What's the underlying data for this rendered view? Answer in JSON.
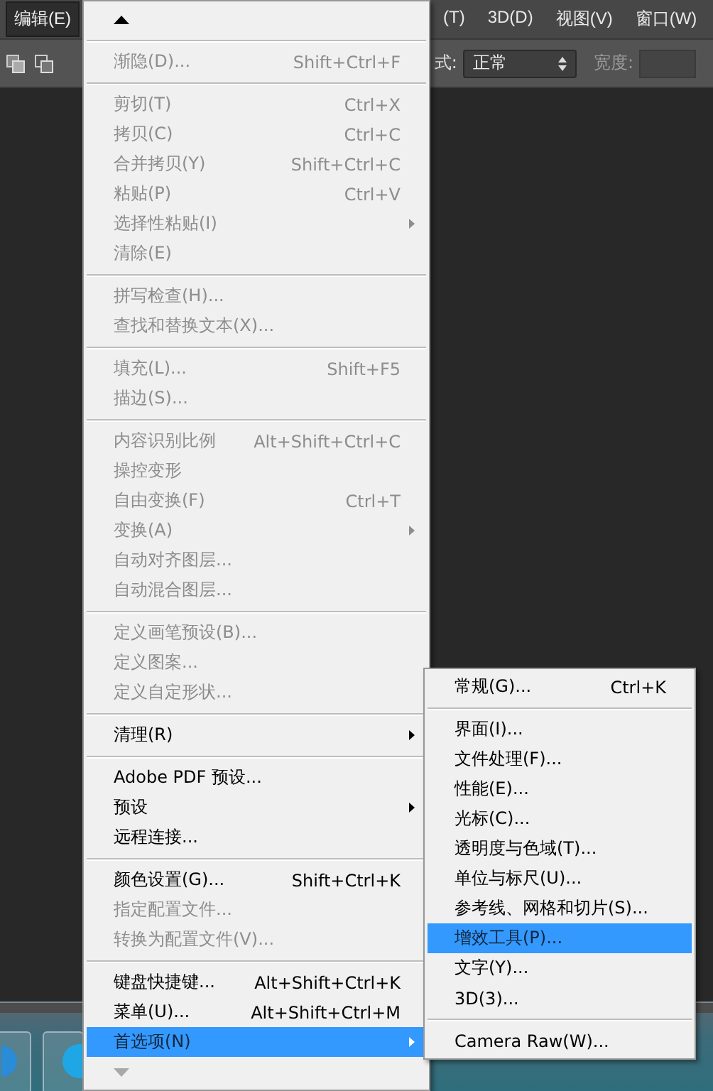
{
  "menu_bar": [
    {
      "label": "编辑(E)",
      "selected": true
    },
    {
      "label": "(T)",
      "selected": false
    },
    {
      "label": "3D(D)",
      "selected": false
    },
    {
      "label": "视图(V)",
      "selected": false
    },
    {
      "label": "窗口(W)",
      "selected": false
    }
  ],
  "options_bar": {
    "style_label": "式:",
    "style_value": "正常",
    "width_label": "宽度:"
  },
  "edit_menu": [
    {
      "kind": "scroll-up",
      "disabled": false
    },
    {
      "kind": "separator"
    },
    {
      "kind": "item",
      "label": "渐隐(D)...",
      "shortcut": "Shift+Ctrl+F",
      "disabled": true,
      "selected": false,
      "submenu": false
    },
    {
      "kind": "separator"
    },
    {
      "kind": "item",
      "label": "剪切(T)",
      "shortcut": "Ctrl+X",
      "disabled": true,
      "selected": false,
      "submenu": false
    },
    {
      "kind": "item",
      "label": "拷贝(C)",
      "shortcut": "Ctrl+C",
      "disabled": true,
      "selected": false,
      "submenu": false
    },
    {
      "kind": "item",
      "label": "合并拷贝(Y)",
      "shortcut": "Shift+Ctrl+C",
      "disabled": true,
      "selected": false,
      "submenu": false
    },
    {
      "kind": "item",
      "label": "粘贴(P)",
      "shortcut": "Ctrl+V",
      "disabled": true,
      "selected": false,
      "submenu": false
    },
    {
      "kind": "item",
      "label": "选择性粘贴(I)",
      "disabled": true,
      "selected": false,
      "submenu": true
    },
    {
      "kind": "item",
      "label": "清除(E)",
      "disabled": true,
      "selected": false,
      "submenu": false
    },
    {
      "kind": "separator"
    },
    {
      "kind": "item",
      "label": "拼写检查(H)...",
      "disabled": true,
      "selected": false,
      "submenu": false
    },
    {
      "kind": "item",
      "label": "查找和替换文本(X)...",
      "disabled": true,
      "selected": false,
      "submenu": false
    },
    {
      "kind": "separator"
    },
    {
      "kind": "item",
      "label": "填充(L)...",
      "shortcut": "Shift+F5",
      "disabled": true,
      "selected": false,
      "submenu": false
    },
    {
      "kind": "item",
      "label": "描边(S)...",
      "disabled": true,
      "selected": false,
      "submenu": false
    },
    {
      "kind": "separator"
    },
    {
      "kind": "item",
      "label": "内容识别比例",
      "shortcut": "Alt+Shift+Ctrl+C",
      "disabled": true,
      "selected": false,
      "submenu": false
    },
    {
      "kind": "item",
      "label": "操控变形",
      "disabled": true,
      "selected": false,
      "submenu": false
    },
    {
      "kind": "item",
      "label": "自由变换(F)",
      "shortcut": "Ctrl+T",
      "disabled": true,
      "selected": false,
      "submenu": false
    },
    {
      "kind": "item",
      "label": "变换(A)",
      "disabled": true,
      "selected": false,
      "submenu": true
    },
    {
      "kind": "item",
      "label": "自动对齐图层...",
      "disabled": true,
      "selected": false,
      "submenu": false
    },
    {
      "kind": "item",
      "label": "自动混合图层...",
      "disabled": true,
      "selected": false,
      "submenu": false
    },
    {
      "kind": "separator"
    },
    {
      "kind": "item",
      "label": "定义画笔预设(B)...",
      "disabled": true,
      "selected": false,
      "submenu": false
    },
    {
      "kind": "item",
      "label": "定义图案...",
      "disabled": true,
      "selected": false,
      "submenu": false
    },
    {
      "kind": "item",
      "label": "定义自定形状...",
      "disabled": true,
      "selected": false,
      "submenu": false
    },
    {
      "kind": "separator"
    },
    {
      "kind": "item",
      "label": "清理(R)",
      "disabled": false,
      "selected": false,
      "submenu": true
    },
    {
      "kind": "separator"
    },
    {
      "kind": "item",
      "label": "Adobe PDF 预设...",
      "disabled": false,
      "selected": false,
      "submenu": false
    },
    {
      "kind": "item",
      "label": "预设",
      "disabled": false,
      "selected": false,
      "submenu": true
    },
    {
      "kind": "item",
      "label": "远程连接...",
      "disabled": false,
      "selected": false,
      "submenu": false
    },
    {
      "kind": "separator"
    },
    {
      "kind": "item",
      "label": "颜色设置(G)...",
      "shortcut": "Shift+Ctrl+K",
      "disabled": false,
      "selected": false,
      "submenu": false
    },
    {
      "kind": "item",
      "label": "指定配置文件...",
      "disabled": true,
      "selected": false,
      "submenu": false
    },
    {
      "kind": "item",
      "label": "转换为配置文件(V)...",
      "disabled": true,
      "selected": false,
      "submenu": false
    },
    {
      "kind": "separator"
    },
    {
      "kind": "item",
      "label": "键盘快捷键...",
      "shortcut": "Alt+Shift+Ctrl+K",
      "disabled": false,
      "selected": false,
      "submenu": false
    },
    {
      "kind": "item",
      "label": "菜单(U)...",
      "shortcut": "Alt+Shift+Ctrl+M",
      "disabled": false,
      "selected": false,
      "submenu": false
    },
    {
      "kind": "item",
      "label": "首选项(N)",
      "disabled": false,
      "selected": true,
      "submenu": true
    },
    {
      "kind": "scroll-down",
      "disabled": true
    }
  ],
  "preferences_submenu": [
    {
      "kind": "item",
      "label": "常规(G)...",
      "shortcut": "Ctrl+K",
      "disabled": false,
      "selected": false,
      "submenu": false
    },
    {
      "kind": "separator"
    },
    {
      "kind": "item",
      "label": "界面(I)...",
      "disabled": false,
      "selected": false,
      "submenu": false
    },
    {
      "kind": "item",
      "label": "文件处理(F)...",
      "disabled": false,
      "selected": false,
      "submenu": false
    },
    {
      "kind": "item",
      "label": "性能(E)...",
      "disabled": false,
      "selected": false,
      "submenu": false
    },
    {
      "kind": "item",
      "label": "光标(C)...",
      "disabled": false,
      "selected": false,
      "submenu": false
    },
    {
      "kind": "item",
      "label": "透明度与色域(T)...",
      "disabled": false,
      "selected": false,
      "submenu": false
    },
    {
      "kind": "item",
      "label": "单位与标尺(U)...",
      "disabled": false,
      "selected": false,
      "submenu": false
    },
    {
      "kind": "item",
      "label": "参考线、网格和切片(S)...",
      "disabled": false,
      "selected": false,
      "submenu": false
    },
    {
      "kind": "item",
      "label": "增效工具(P)...",
      "disabled": false,
      "selected": true,
      "submenu": false
    },
    {
      "kind": "item",
      "label": "文字(Y)...",
      "disabled": false,
      "selected": false,
      "submenu": false
    },
    {
      "kind": "item",
      "label": "3D(3)...",
      "disabled": false,
      "selected": false,
      "submenu": false
    },
    {
      "kind": "separator"
    },
    {
      "kind": "item",
      "label": "Camera Raw(W)...",
      "disabled": false,
      "selected": false,
      "submenu": false
    }
  ]
}
